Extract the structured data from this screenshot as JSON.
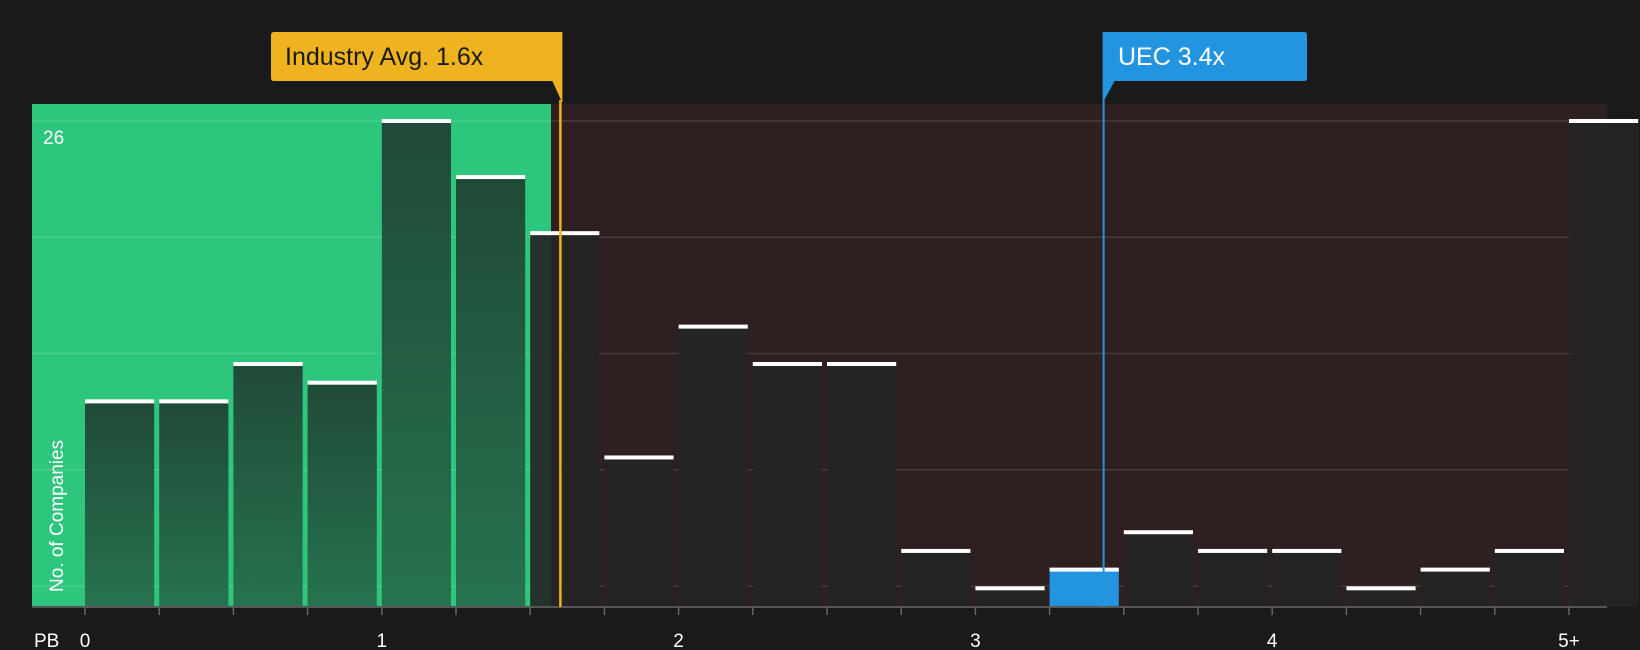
{
  "chart_data": {
    "type": "bar",
    "x_axis_label": "PB",
    "y_axis_label": "No. of Companies",
    "y_max_label": "26",
    "ylim": [
      0,
      26
    ],
    "x_ticks": [
      "0",
      "1",
      "2",
      "3",
      "4",
      "5+"
    ],
    "bins_start": 0,
    "bin_width": 0.25,
    "values": [
      11,
      11,
      13,
      12,
      26,
      23,
      20,
      8,
      15,
      13,
      13,
      3,
      1,
      2,
      4,
      3,
      3,
      1,
      2,
      3,
      26
    ],
    "highlight_bin_index": 13,
    "grid": true,
    "industry_avg": {
      "label": "Industry Avg. 1.6x",
      "value": 1.6
    },
    "company": {
      "label": "UEC 3.4x",
      "value": 3.4
    },
    "colors": {
      "background": "#1a1a1a",
      "green_region": "#2ec67c",
      "red_region": "#2e1f20",
      "bar_fill": "#252424",
      "bar_cap": "#ffffff",
      "highlight": "#2394e0",
      "industry": "#efb31f",
      "company": "#2394e0"
    }
  }
}
